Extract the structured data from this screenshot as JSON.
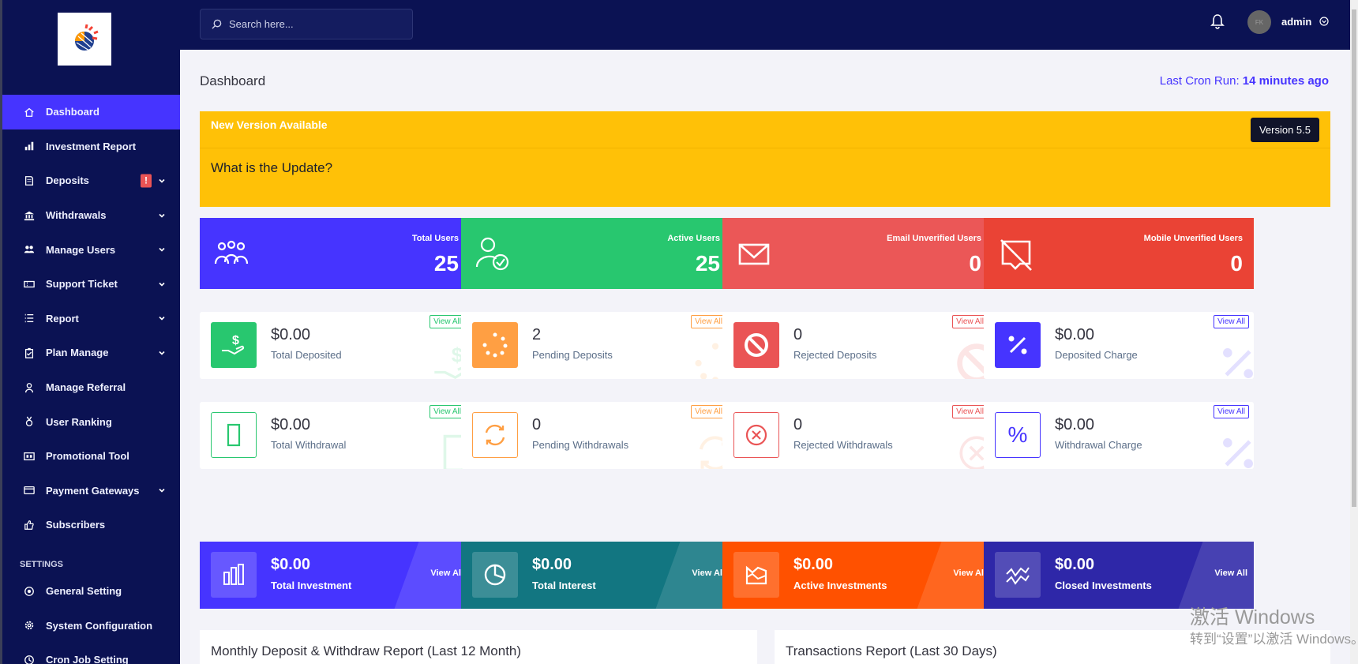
{
  "sidebar": {
    "items": [
      {
        "label": "Dashboard",
        "icon": "home-icon",
        "active": true
      },
      {
        "label": "Investment Report",
        "icon": "bar-chart-icon"
      },
      {
        "label": "Deposits",
        "icon": "invoice-icon",
        "badge": "!",
        "caret": true
      },
      {
        "label": "Withdrawals",
        "icon": "bank-icon",
        "caret": true
      },
      {
        "label": "Manage Users",
        "icon": "users-icon",
        "caret": true
      },
      {
        "label": "Support Ticket",
        "icon": "ticket-icon",
        "caret": true
      },
      {
        "label": "Report",
        "icon": "list-icon",
        "caret": true
      },
      {
        "label": "Plan Manage",
        "icon": "clipboard-icon",
        "caret": true
      },
      {
        "label": "Manage Referral",
        "icon": "referral-icon"
      },
      {
        "label": "User Ranking",
        "icon": "medal-icon"
      },
      {
        "label": "Promotional Tool",
        "icon": "promo-icon"
      },
      {
        "label": "Payment Gateways",
        "icon": "card-icon",
        "caret": true
      },
      {
        "label": "Subscribers",
        "icon": "thumbs-up-icon"
      }
    ],
    "settings_heading": "SETTINGS",
    "settings_items": [
      {
        "label": "General Setting",
        "icon": "settings-circle-icon"
      },
      {
        "label": "System Configuration",
        "icon": "gear-icon"
      },
      {
        "label": "Cron Job Setting",
        "icon": "clock-icon"
      }
    ]
  },
  "topbar": {
    "search_placeholder": "Search here...",
    "username": "admin",
    "avatar_text": "FK"
  },
  "page": {
    "title": "Dashboard",
    "cron_label": "Last Cron Run:",
    "cron_value": "14 minutes ago"
  },
  "update_banner": {
    "title": "New Version Available",
    "question": "What is the Update?",
    "version": "Version 5.5"
  },
  "stats": [
    {
      "label": "Total Users",
      "value": "25",
      "color": "#4634ff",
      "icon": "users-group-icon"
    },
    {
      "label": "Active Users",
      "value": "25",
      "color": "#28c76f",
      "icon": "user-check-icon"
    },
    {
      "label": "Email Unverified Users",
      "value": "0",
      "color": "#eb5757",
      "icon": "envelope-icon"
    },
    {
      "label": "Mobile Unverified Users",
      "value": "0",
      "color": "#ea4335",
      "icon": "mobile-off-icon"
    }
  ],
  "deposit_widgets": [
    {
      "value": "$0.00",
      "label": "Total Deposited",
      "view": "View All",
      "color": "#28c76f",
      "icon": "hand-dollar-icon"
    },
    {
      "value": "2",
      "label": "Pending Deposits",
      "view": "View All",
      "color": "#ff9f43",
      "icon": "spinner-icon"
    },
    {
      "value": "0",
      "label": "Rejected Deposits",
      "view": "View All",
      "color": "#ea5455",
      "icon": "ban-icon"
    },
    {
      "value": "$0.00",
      "label": "Deposited Charge",
      "view": "View All",
      "color": "#4634ff",
      "icon": "percent-icon"
    }
  ],
  "withdraw_widgets": [
    {
      "value": "$0.00",
      "label": "Total Withdrawal",
      "view": "View All",
      "color": "#28c76f",
      "icon": "wallet-icon"
    },
    {
      "value": "0",
      "label": "Pending Withdrawals",
      "view": "View All",
      "color": "#ff9f43",
      "icon": "sync-icon"
    },
    {
      "value": "0",
      "label": "Rejected Withdrawals",
      "view": "View All",
      "color": "#ea5455",
      "icon": "x-circle-icon"
    },
    {
      "value": "$0.00",
      "label": "Withdrawal Charge",
      "view": "View All",
      "color": "#4634ff",
      "icon": "percent-icon"
    }
  ],
  "investment_cards": [
    {
      "value": "$0.00",
      "label": "Total Investment",
      "view": "View All",
      "color": "#4634ff",
      "icon": "bar-chart-icon"
    },
    {
      "value": "$0.00",
      "label": "Total Interest",
      "view": "View All",
      "color": "#127681",
      "icon": "pie-chart-icon"
    },
    {
      "value": "$0.00",
      "label": "Active Investments",
      "view": "View All",
      "color": "#ff5100",
      "icon": "area-chart-icon"
    },
    {
      "value": "$0.00",
      "label": "Closed Investments",
      "view": "View All",
      "color": "#2e27a8",
      "icon": "line-chart-icon"
    }
  ],
  "reports": [
    {
      "title": "Monthly Deposit & Withdraw Report (Last 12 Month)"
    },
    {
      "title": "Transactions Report (Last 30 Days)"
    }
  ],
  "watermark": {
    "line1": "激活 Windows",
    "line2": "转到“设置”以激活 Windows。"
  }
}
